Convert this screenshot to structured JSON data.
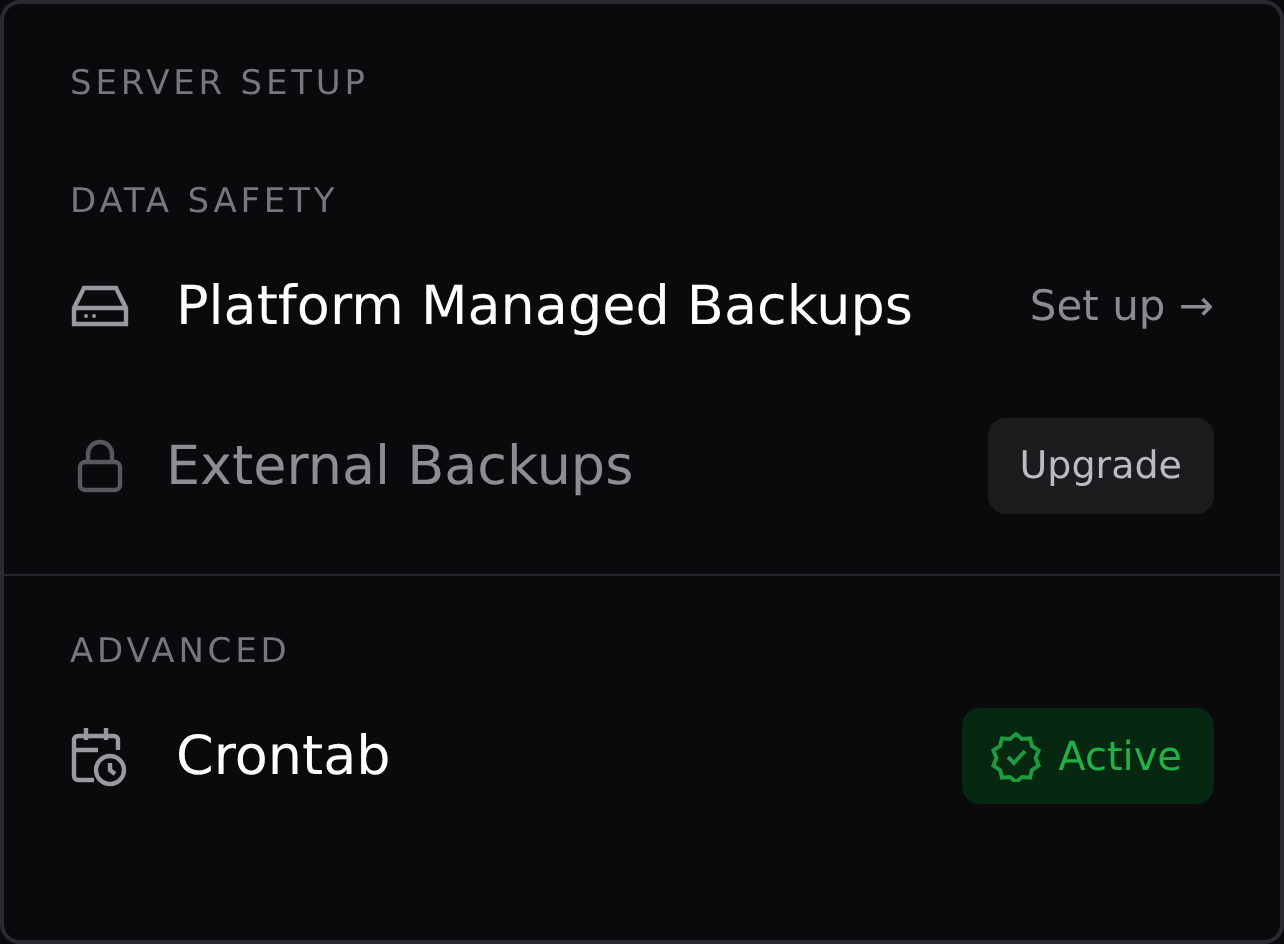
{
  "title": "SERVER SETUP",
  "sections": [
    {
      "heading": "DATA SAFETY",
      "items": [
        {
          "label": "Platform Managed Backups",
          "disabled": false,
          "action": {
            "kind": "link",
            "label": "Set up →"
          }
        },
        {
          "label": "External Backups",
          "disabled": true,
          "action": {
            "kind": "button",
            "label": "Upgrade"
          }
        }
      ]
    },
    {
      "heading": "ADVANCED",
      "items": [
        {
          "label": "Crontab",
          "disabled": false,
          "action": {
            "kind": "status",
            "label": "Active"
          }
        }
      ]
    }
  ]
}
